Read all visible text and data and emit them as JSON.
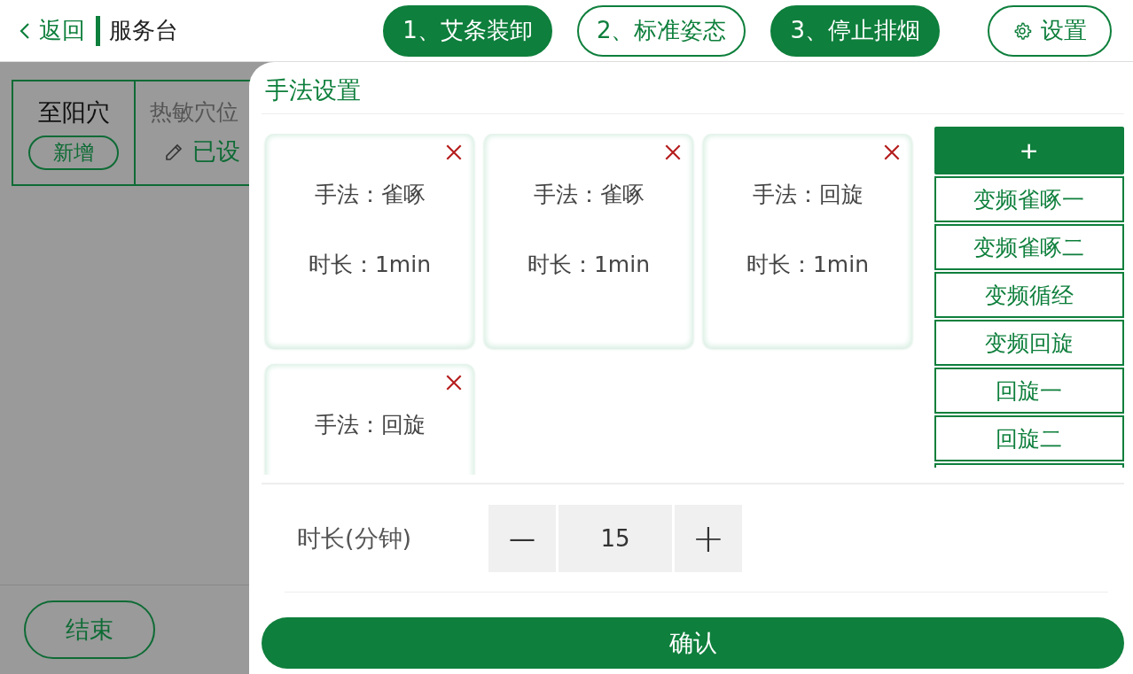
{
  "header": {
    "back": "返回",
    "title": "服务台",
    "steps": [
      {
        "label": "1、艾条装卸",
        "selected": true
      },
      {
        "label": "2、标准姿态",
        "selected": false
      },
      {
        "label": "3、停止排烟",
        "selected": true
      }
    ],
    "settings": "设置"
  },
  "background": {
    "point": {
      "name": "至阳穴",
      "add": "新增",
      "type_label": "热敏穴位",
      "status": "已设"
    },
    "end_button": "结束"
  },
  "dialog": {
    "title": "手法设置",
    "cards": [
      {
        "method": "手法：雀啄",
        "duration": "时长：1min"
      },
      {
        "method": "手法：雀啄",
        "duration": "时长：1min"
      },
      {
        "method": "手法：回旋",
        "duration": "时长：1min"
      },
      {
        "method": "手法：回旋"
      }
    ],
    "add_button": "+",
    "presets": [
      "变频雀啄一",
      "变频雀啄二",
      "变频循经",
      "变频回旋",
      "回旋一",
      "回旋二"
    ],
    "duration_label": "时长(分钟)",
    "stepper": {
      "minus": "—",
      "value": "15",
      "plus": "+"
    },
    "confirm": "确认"
  }
}
